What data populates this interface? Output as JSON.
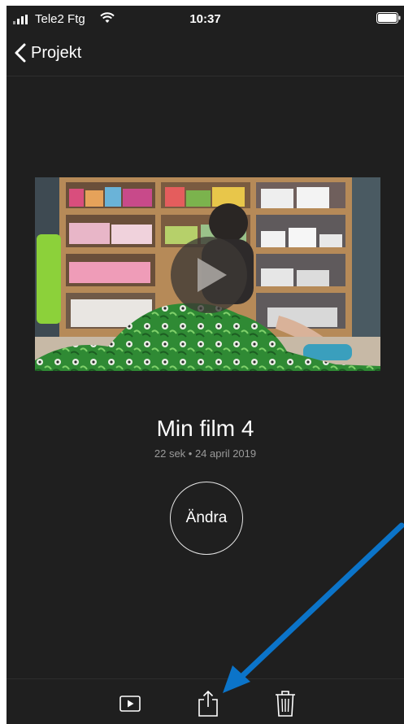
{
  "status_bar": {
    "carrier": "Tele2 Ftg",
    "time": "10:37",
    "icons": [
      "signal-icon",
      "wifi-icon",
      "battery-icon"
    ]
  },
  "nav": {
    "back_label": "Projekt",
    "back_icon": "chevron-left-icon"
  },
  "project": {
    "title": "Min film 4",
    "meta": "22 sek • 24 april 2019",
    "thumbnail_icon": "play-icon"
  },
  "actions": {
    "edit_label": "Ändra"
  },
  "toolbar": {
    "items": [
      "play-icon",
      "share-icon",
      "trash-icon"
    ]
  },
  "annotation": {
    "arrow_color": "#0b74c9",
    "target": "share-button"
  },
  "colors": {
    "background": "#1f1f1f",
    "text": "#ffffff",
    "subtext": "#9a9a9a"
  }
}
